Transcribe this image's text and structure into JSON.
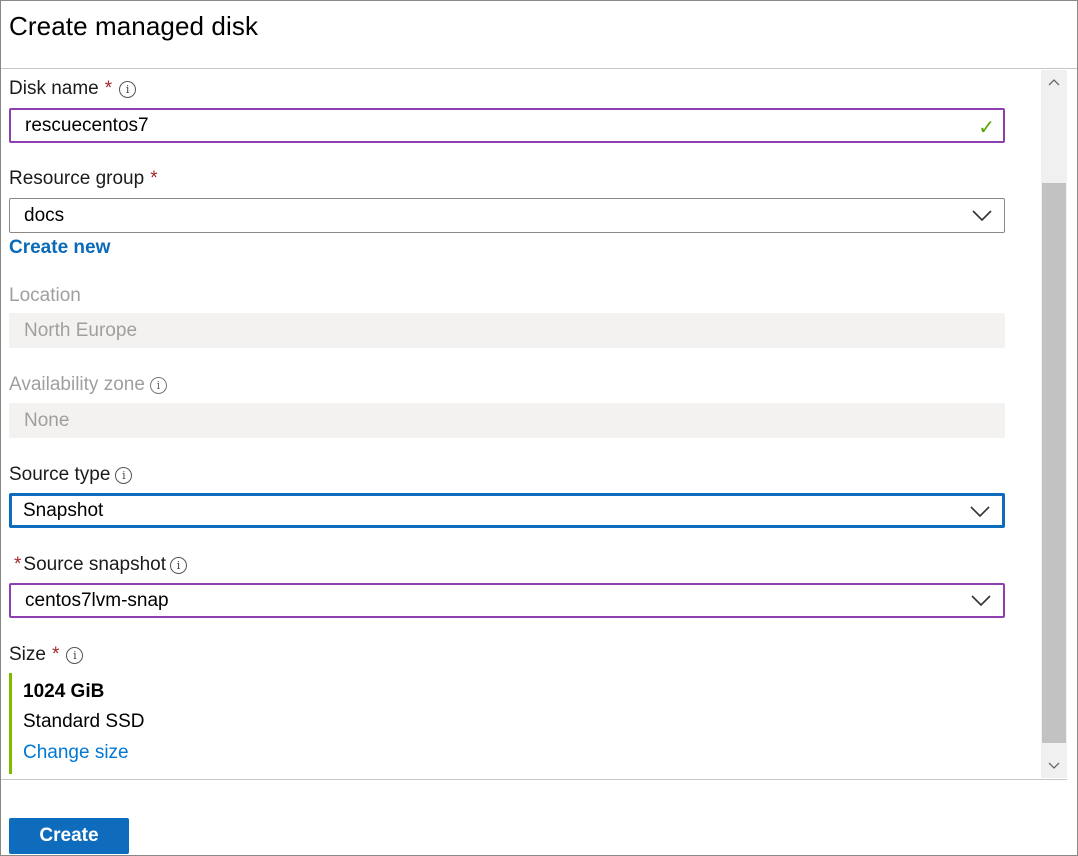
{
  "window": {
    "title": "Create managed disk"
  },
  "form": {
    "disk_name": {
      "label": "Disk name",
      "required_mark": "*",
      "value": "rescuecentos7",
      "valid": true
    },
    "resource_group": {
      "label": "Resource group",
      "required_mark": "*",
      "value": "docs",
      "create_new_link": "Create new"
    },
    "location": {
      "label": "Location",
      "value": "North Europe",
      "disabled": true
    },
    "availability_zone": {
      "label": "Availability zone",
      "value": "None",
      "disabled": true
    },
    "source_type": {
      "label": "Source type",
      "value": "Snapshot",
      "focused": true
    },
    "source_snapshot": {
      "required_mark": "*",
      "label": "Source snapshot",
      "value": "centos7lvm-snap"
    },
    "size": {
      "label": "Size",
      "required_mark": "*",
      "amount": "1024 GiB",
      "sku": "Standard SSD",
      "change_link": "Change size"
    }
  },
  "footer": {
    "create_label": "Create"
  },
  "colors": {
    "accent": "#0f6cbd",
    "link": "#0078d4",
    "required": "#a4262c",
    "valid": "#57a300",
    "selected_border": "#8e3fb0",
    "size_bar": "#7fba00"
  }
}
